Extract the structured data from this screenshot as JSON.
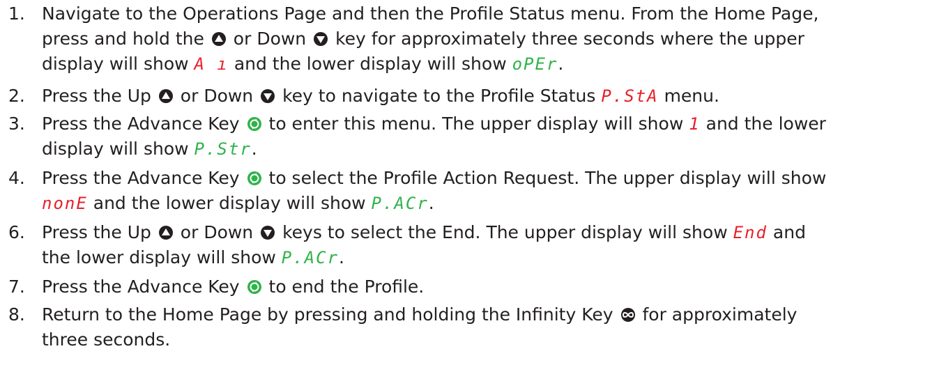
{
  "steps": [
    {
      "num": "1.",
      "l1": "Navigate to the Operations Page and then the Profile Status menu. From the Home Page,",
      "l2a": "press and hold the",
      "l2b": "or Down",
      "l2c": "key for approximately three seconds where the upper",
      "l3a": "display will show",
      "upper": "A ı",
      "l3b": "and the lower display will show",
      "lower": "oPEr",
      "l3c": "."
    },
    {
      "num": "2.",
      "a": "Press the Up",
      "b": "or Down",
      "c": "key to navigate to the Profile Status",
      "disp": "P.StA",
      "d": "menu."
    },
    {
      "num": "3.",
      "a": "Press the Advance Key",
      "b": "to enter this menu. The upper display will show",
      "upper": "1",
      "c": "and the lower",
      "l2a": "display will show",
      "lower": "P.Str",
      "l2b": "."
    },
    {
      "num": "4.",
      "a": "Press the Advance Key",
      "b": "to select the Profile Action Request. The upper display will show",
      "upper": "nonE",
      "c": "and the lower display will show",
      "lower": "P.ACr",
      "d": "."
    },
    {
      "num": "6.",
      "a": "Press the Up",
      "b": "or Down",
      "c": "keys to select the End. The upper display will show",
      "upper": "End",
      "d": "and",
      "l2a": "the lower display will show",
      "lower": "P.ACr",
      "l2b": "."
    },
    {
      "num": "7.",
      "a": "Press the Advance Key",
      "b": "to end the Profile."
    },
    {
      "num": "8.",
      "a": "Return to the Home Page by pressing and holding the Infinity Key",
      "b": "for approximately",
      "l2": "three seconds."
    }
  ],
  "icons": {
    "up": "up-arrow-key-icon",
    "down": "down-arrow-key-icon",
    "advance": "advance-key-icon",
    "infinity": "infinity-key-icon"
  },
  "colors": {
    "text": "#231f20",
    "upper_display": "#e8202a",
    "lower_display": "#2fb34a"
  }
}
